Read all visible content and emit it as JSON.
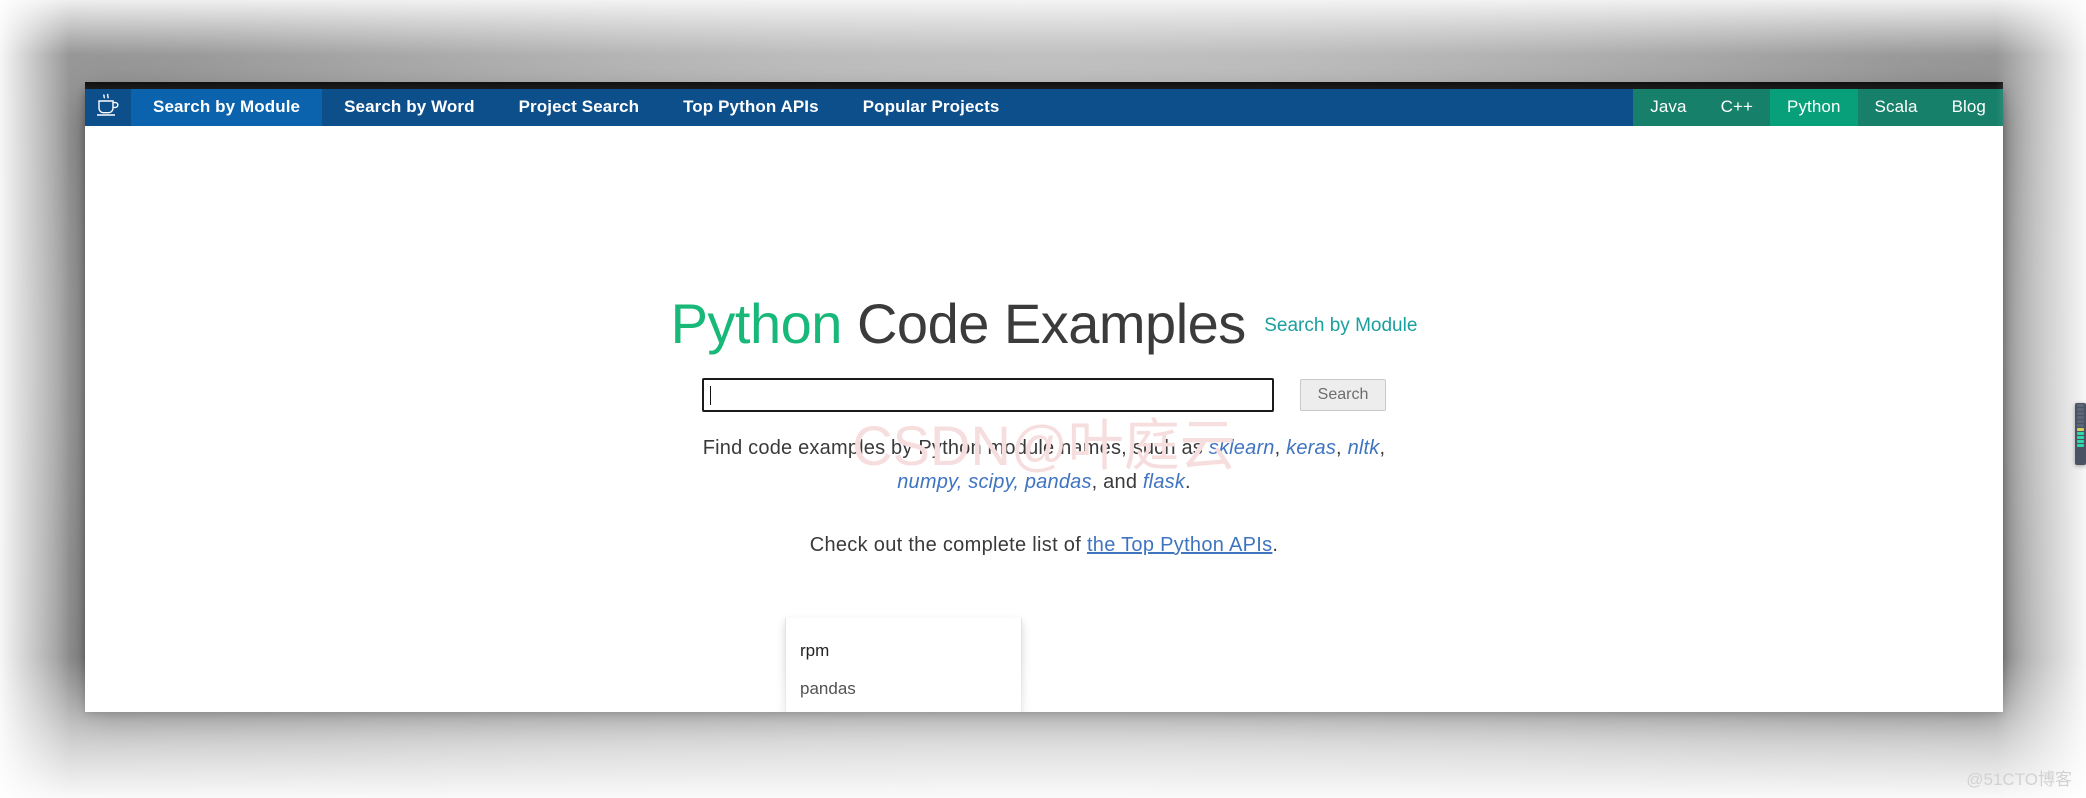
{
  "nav": {
    "logo_icon": "coffee-cup-icon",
    "left_items": [
      {
        "label": "Search by Module",
        "active": true
      },
      {
        "label": "Search by Word",
        "active": false
      },
      {
        "label": "Project Search",
        "active": false
      },
      {
        "label": "Top Python APIs",
        "active": false
      },
      {
        "label": "Popular Projects",
        "active": false
      }
    ],
    "right_items": [
      {
        "label": "Java",
        "active": false
      },
      {
        "label": "C++",
        "active": false
      },
      {
        "label": "Python",
        "active": true
      },
      {
        "label": "Scala",
        "active": false
      },
      {
        "label": "Blog",
        "active": false
      }
    ],
    "colors": {
      "bar": "#0d4f8b",
      "active": "#0b62ad",
      "right_bar": "#17806a",
      "right_active": "#07a07a"
    }
  },
  "hero": {
    "title_lang": "Python",
    "title_rest": " Code Examples",
    "subtitle": "Search by Module",
    "lang_color": "#18b879",
    "subtitle_color": "#1a9f9f"
  },
  "search": {
    "value": "",
    "placeholder": "",
    "button_label": "Search",
    "suggestions": [
      "rpm",
      "pandas"
    ]
  },
  "description": {
    "line1_pre": "Find code examples by Python module names, such as ",
    "line1_mods": [
      "sklearn",
      "keras",
      "nltk"
    ],
    "line2_pre": "numpy, scipy, ",
    "line2_mods": [
      "pandas",
      "flask"
    ],
    "line2_mid": ", and ",
    "line2_end": ".",
    "module_color": "#3f74c0"
  },
  "footnote": {
    "pre": "Check out the complete list of ",
    "link": "the Top Python APIs",
    "post": "."
  },
  "watermarks": {
    "center": "CSDN@叶庭云",
    "bottom_right": "@51CTO博客"
  }
}
